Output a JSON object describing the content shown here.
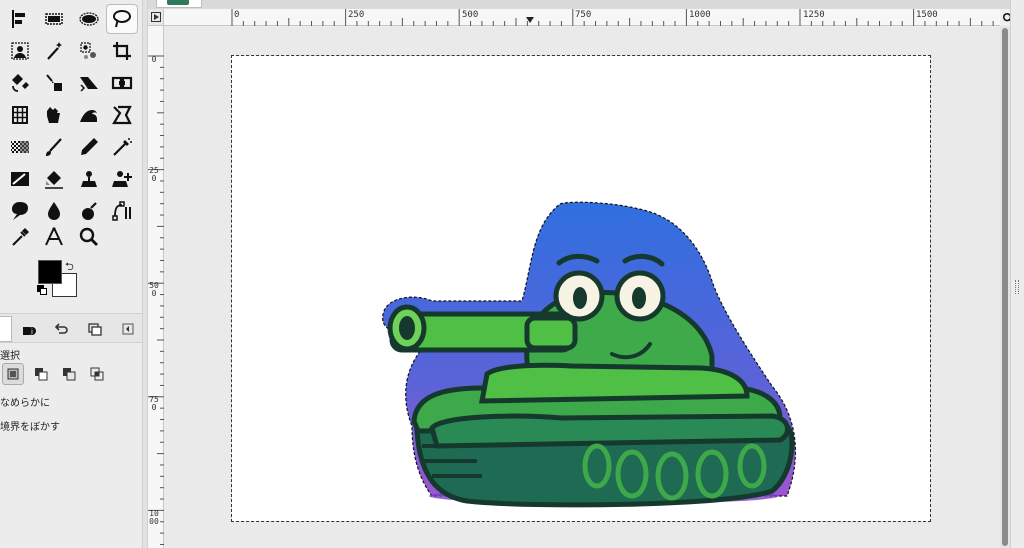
{
  "toolbox": {
    "tools": [
      {
        "name": "alignment-tool-icon"
      },
      {
        "name": "rect-select-icon"
      },
      {
        "name": "ellipse-select-icon"
      },
      {
        "name": "free-select-icon",
        "active": true
      },
      {
        "name": "foreground-select-icon"
      },
      {
        "name": "fuzzy-select-icon"
      },
      {
        "name": "select-by-color-icon"
      },
      {
        "name": "crop-icon"
      },
      {
        "name": "unified-transform-icon"
      },
      {
        "name": "warp-transform-icon"
      },
      {
        "name": "flip-icon"
      },
      {
        "name": "handle-transform-icon"
      },
      {
        "name": "grid-transform-icon"
      },
      {
        "name": "bucket-fill-icon"
      },
      {
        "name": "smudge-icon"
      },
      {
        "name": "path-icon"
      },
      {
        "name": "gradient-icon"
      },
      {
        "name": "paintbrush-icon"
      },
      {
        "name": "ink-pen-icon"
      },
      {
        "name": "airbrush-icon"
      },
      {
        "name": "mypaint-brush-icon"
      },
      {
        "name": "eraser-icon"
      },
      {
        "name": "clone-icon"
      },
      {
        "name": "heal-icon"
      },
      {
        "name": "blur-icon"
      },
      {
        "name": "dodge-burn-icon"
      },
      {
        "name": "ink-icon"
      },
      {
        "name": "paths-tool-icon"
      },
      {
        "name": "color-picker-icon"
      },
      {
        "name": "measure-icon"
      },
      {
        "name": "zoom-icon"
      }
    ],
    "colors": {
      "foreground": "#000000",
      "background": "#ffffff"
    }
  },
  "tool_options": {
    "title": "選択",
    "antialias_label": "なめらかに",
    "feather_label": "境界をぼかす"
  },
  "rulers": {
    "top_labels": [
      "0",
      "250",
      "500",
      "750",
      "1000",
      "1250",
      "1500"
    ],
    "left_labels": [
      "0",
      "250",
      "500",
      "750",
      "1000"
    ]
  }
}
